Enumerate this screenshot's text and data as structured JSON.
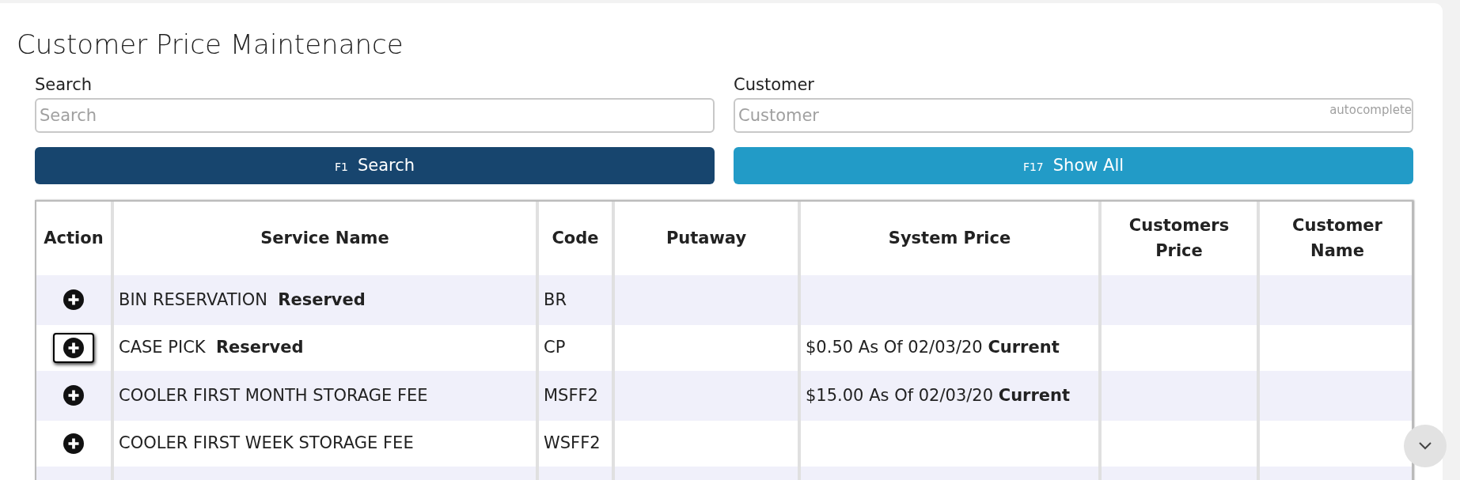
{
  "title": "Customer Price Maintenance",
  "search": {
    "label": "Search",
    "placeholder": "Search"
  },
  "customer": {
    "label": "Customer",
    "placeholder": "Customer",
    "hint": "autocomplete"
  },
  "buttons": [
    {
      "kind": "primary",
      "key": "F1",
      "label": "Search"
    },
    {
      "kind": "secondary",
      "key": "F17",
      "label": "Show All"
    }
  ],
  "table": {
    "columns": [
      "Action",
      "Service Name",
      "Code",
      "Putaway",
      "System Price",
      "Customers Price",
      "Customer Name"
    ],
    "rows": [
      {
        "focused": false,
        "service_name": "BIN RESERVATION  **Reserved**",
        "code": "BR",
        "putaway": "",
        "system_price": "",
        "customers_price": "",
        "customer_name": ""
      },
      {
        "focused": true,
        "service_name": "CASE PICK  **Reserved**",
        "code": "CP",
        "putaway": "",
        "system_price": "$0.50 As Of 02/03/20 **Current**",
        "customers_price": "",
        "customer_name": ""
      },
      {
        "focused": false,
        "service_name": "COOLER FIRST MONTH STORAGE FEE",
        "code": "MSFF2",
        "putaway": "",
        "system_price": "$15.00 As Of 02/03/20 **Current**",
        "customers_price": "",
        "customer_name": ""
      },
      {
        "focused": false,
        "service_name": "COOLER FIRST WEEK STORAGE FEE",
        "code": "WSFF2",
        "putaway": "",
        "system_price": "",
        "customers_price": "",
        "customer_name": ""
      }
    ]
  }
}
